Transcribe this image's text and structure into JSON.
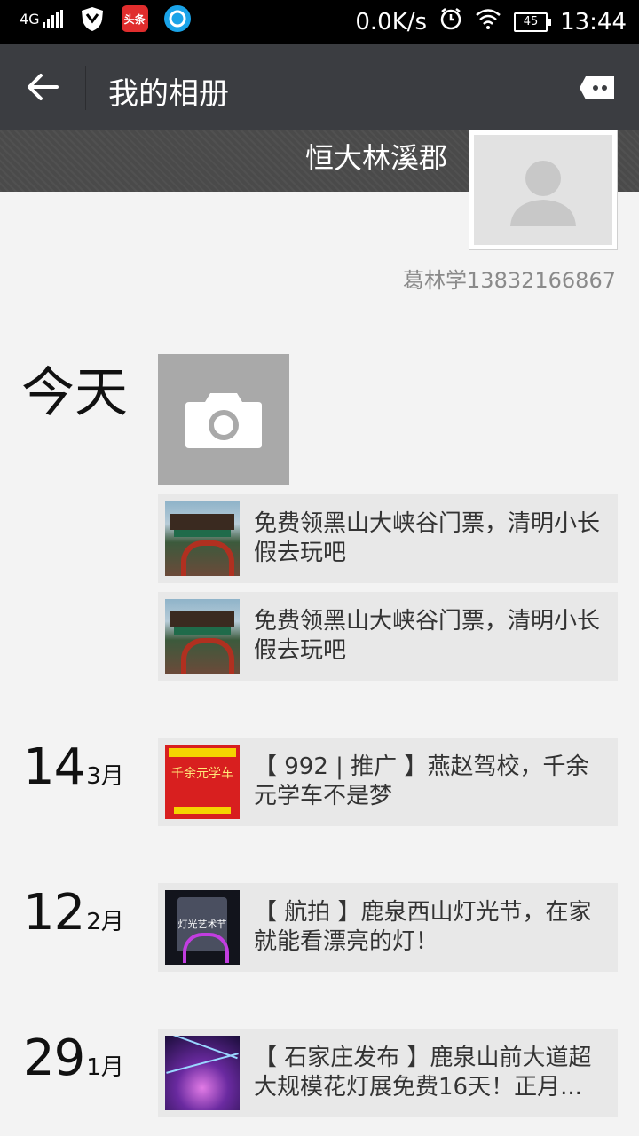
{
  "status_bar": {
    "network": "4G",
    "toutiao_label": "头条",
    "speed": "0.0K/s",
    "battery": "45",
    "time": "13:44"
  },
  "app_bar": {
    "title": "我的相册"
  },
  "profile": {
    "cover_name": "恒大林溪郡",
    "nickname": "葛林学13832166867"
  },
  "timeline": {
    "today_label": "今天",
    "today_posts": [
      {
        "text": "免费领黑山大峡谷门票，清明小长假去玩吧"
      },
      {
        "text": "免费领黑山大峡谷门票，清明小长假去玩吧"
      }
    ],
    "entries": [
      {
        "day": "14",
        "month": "3月",
        "text": "【 992 | 推广 】燕赵驾校，千余元学车不是梦",
        "thumb_text": "千余元学车"
      },
      {
        "day": "12",
        "month": "2月",
        "text": "【 航拍 】鹿泉西山灯光节，在家就能看漂亮的灯！",
        "thumb_text": "灯光艺术节"
      },
      {
        "day": "29",
        "month": "1月",
        "text": "【 石家庄发布 】鹿泉山前大道超大规模花灯展免费16天！正月..."
      }
    ]
  }
}
